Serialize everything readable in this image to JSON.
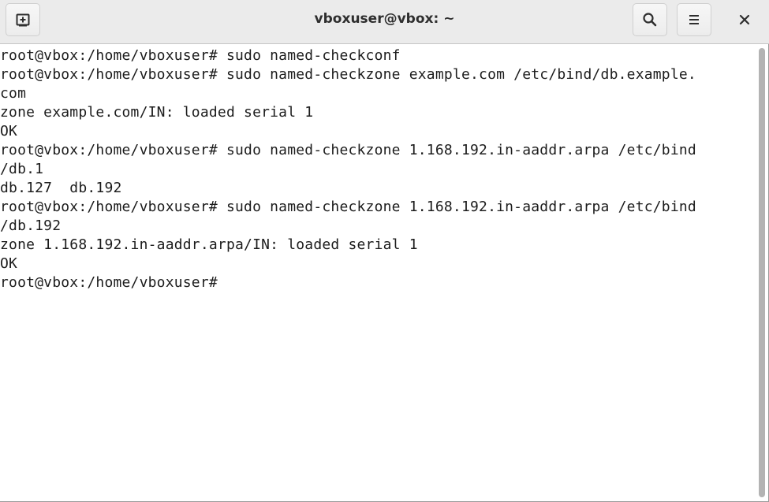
{
  "window": {
    "title": "vboxuser@vbox: ~"
  },
  "header": {
    "buttons": [
      {
        "name": "new-tab",
        "icon": "plus-in-square-icon"
      },
      {
        "name": "search",
        "icon": "search-icon"
      },
      {
        "name": "menu",
        "icon": "hamburger-menu-icon"
      },
      {
        "name": "close",
        "icon": "close-icon"
      }
    ]
  },
  "terminal": {
    "lines": [
      "root@vbox:/home/vboxuser# sudo named-checkconf",
      "root@vbox:/home/vboxuser# sudo named-checkzone example.com /etc/bind/db.example.",
      "com",
      "zone example.com/IN: loaded serial 1",
      "OK",
      "root@vbox:/home/vboxuser# sudo named-checkzone 1.168.192.in-aaddr.arpa /etc/bind",
      "/db.1",
      "db.127  db.192",
      "root@vbox:/home/vboxuser# sudo named-checkzone 1.168.192.in-aaddr.arpa /etc/bind",
      "/db.192",
      "zone 1.168.192.in-aaddr.arpa/IN: loaded serial 1",
      "OK",
      "root@vbox:/home/vboxuser# "
    ]
  },
  "colors": {
    "titlebar_bg": "#ebebeb",
    "terminal_bg": "#ffffff",
    "terminal_fg": "#1c1c1c",
    "scrollbar_thumb": "#b3b3b3"
  }
}
